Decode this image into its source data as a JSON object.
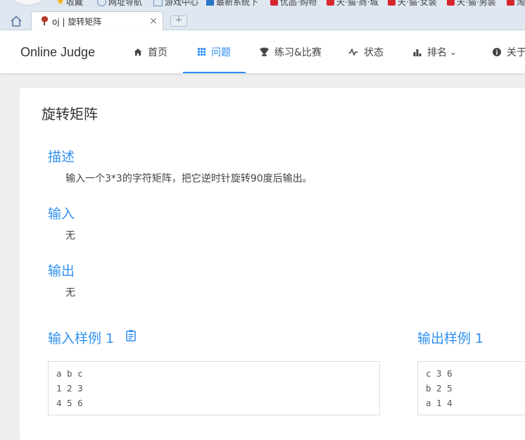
{
  "browser": {
    "bookmarks": [
      {
        "label": "收藏",
        "icon": "star-icon"
      },
      {
        "label": "网址导航",
        "icon": "globe-icon"
      },
      {
        "label": "游戏中心",
        "icon": "game-icon"
      },
      {
        "label": "最新系统下",
        "icon": "news-icon"
      },
      {
        "label": "优品·购物",
        "icon": "tmall-icon"
      },
      {
        "label": "天·猫·商·城",
        "icon": "tmall-icon"
      },
      {
        "label": "天·猫·女装",
        "icon": "tmall-icon"
      },
      {
        "label": "天·猫·男装",
        "icon": "tmall-icon"
      },
      {
        "label": "淘",
        "icon": "tmall-icon"
      }
    ],
    "tab": {
      "title": "oj | 旋转矩阵",
      "close": "×"
    },
    "new_tab": "+"
  },
  "navbar": {
    "brand": "Online Judge",
    "items": [
      {
        "label": "首页",
        "icon": "home-icon"
      },
      {
        "label": "问题",
        "icon": "grid-icon",
        "active": true
      },
      {
        "label": "练习&比赛",
        "icon": "trophy-icon"
      },
      {
        "label": "状态",
        "icon": "pulse-icon"
      },
      {
        "label": "排名",
        "icon": "bar-chart-icon",
        "dropdown": "⌄"
      },
      {
        "label": "关于",
        "icon": "info-icon"
      }
    ]
  },
  "problem": {
    "title": "旋转矩阵",
    "description": {
      "heading": "描述",
      "text": "输入一个3*3的字符矩阵，把它逆时针旋转90度后输出。"
    },
    "input": {
      "heading": "输入",
      "text": "无"
    },
    "output": {
      "heading": "输出",
      "text": "无"
    },
    "sample_input": {
      "heading": "输入样例 1",
      "lines": [
        "a b c",
        "1 2 3",
        "4 5 6"
      ]
    },
    "sample_output": {
      "heading": "输出样例 1",
      "lines": [
        "c 3 6",
        "b 2 5",
        "a 1 4"
      ]
    }
  }
}
